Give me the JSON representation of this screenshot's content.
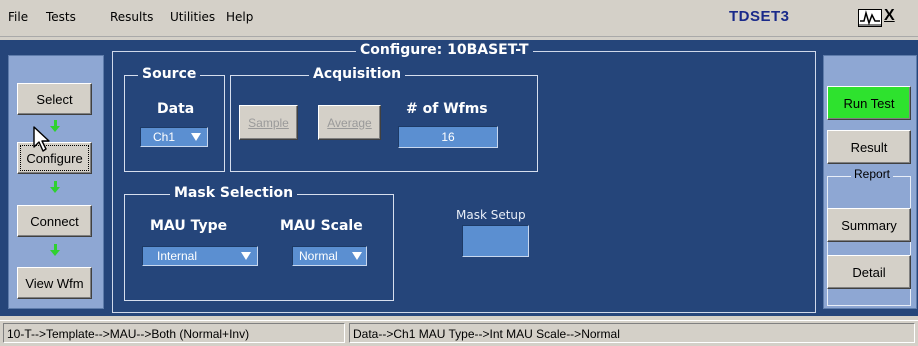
{
  "menubar": {
    "items": [
      "File",
      "Tests",
      "Results",
      "Utilities",
      "Help"
    ],
    "app_title": "TDSET3",
    "close_label": "X",
    "window_icon": "waveform-icon"
  },
  "nav": {
    "select": "Select",
    "configure": "Configure",
    "connect": "Connect",
    "view_wfm": "View Wfm"
  },
  "panel": {
    "title": "Configure: 10BASET-T",
    "source": {
      "legend": "Source",
      "data_label": "Data",
      "data_value": "Ch1"
    },
    "acquisition": {
      "legend": "Acquisition",
      "sample_label": "Sample",
      "average_label": "Average",
      "wfms_label": "# of Wfms",
      "wfms_value": "16"
    },
    "mask_selection": {
      "legend": "Mask Selection",
      "mau_type_label": "MAU Type",
      "mau_type_value": "Internal",
      "mau_scale_label": "MAU Scale",
      "mau_scale_value": "Normal"
    },
    "mask_setup_label": "Mask Setup"
  },
  "actions": {
    "run_test": "Run Test",
    "result": "Result",
    "report_legend": "Report",
    "summary": "Summary",
    "detail": "Detail"
  },
  "status": {
    "left": "10-T-->Template-->MAU-->Both (Normal+Inv)",
    "right": "Data-->Ch1   MAU Type-->Int   MAU Scale-->Normal"
  },
  "colors": {
    "panel_bg": "#25457a",
    "side_panel": "#8ea7d3",
    "field_bg": "#5b8fd1",
    "run_button": "#2ee22e",
    "title_text": "#1a2a8a",
    "flow_arrow": "#2fd12f"
  }
}
